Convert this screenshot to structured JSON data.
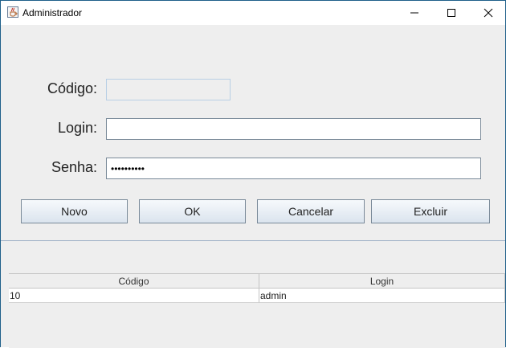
{
  "window": {
    "title": "Administrador",
    "icon": "java-cup-icon",
    "controls": {
      "minimize": "—",
      "maximize": "☐",
      "close": "✕"
    }
  },
  "form": {
    "codigo": {
      "label": "Código:",
      "value": "",
      "placeholder": ""
    },
    "login": {
      "label": "Login:",
      "value": "",
      "placeholder": ""
    },
    "senha": {
      "label": "Senha:",
      "masked_value": "••••••••••"
    }
  },
  "buttons": {
    "novo": "Novo",
    "ok": "OK",
    "cancelar": "Cancelar",
    "excluir": "Excluir"
  },
  "table": {
    "columns": [
      "Código",
      "Login"
    ],
    "rows": [
      {
        "codigo": "10",
        "login": "admin"
      }
    ]
  },
  "colors": {
    "window_border": "#1f5f8a",
    "background": "#eeeeee",
    "button_gradient_top": "#f6f9fc",
    "button_gradient_bottom": "#dbe4ee"
  }
}
